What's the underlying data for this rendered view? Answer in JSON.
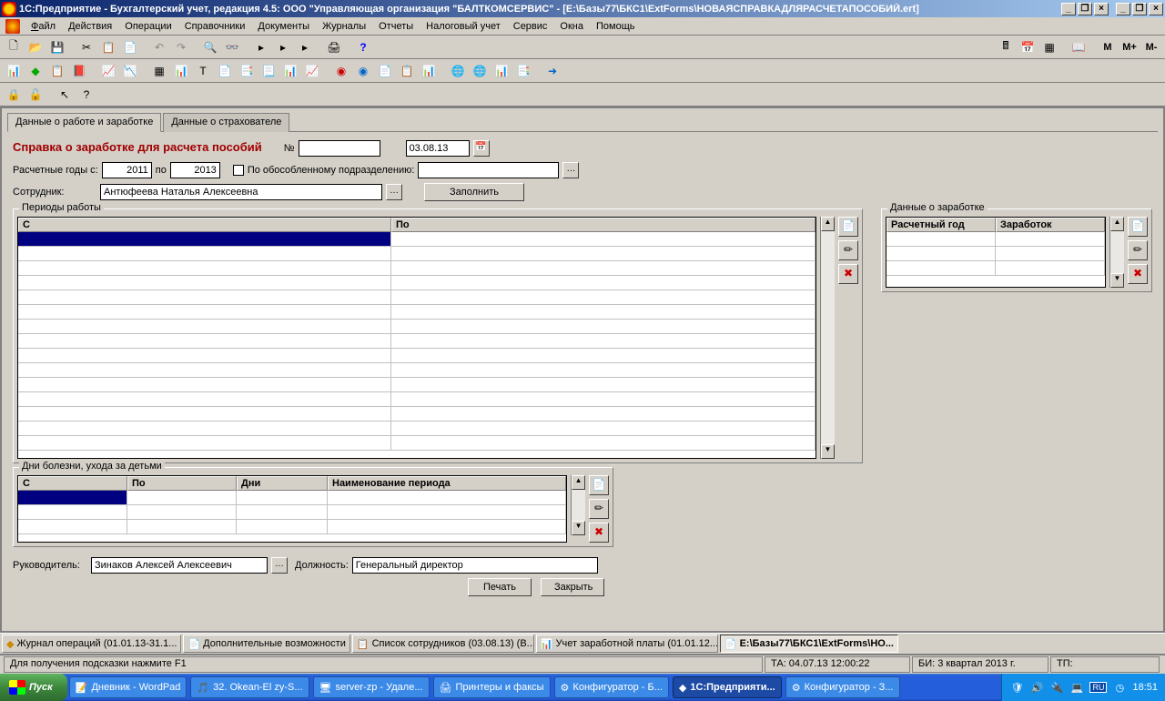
{
  "titlebar": {
    "text": "1С:Предприятие - Бухгалтерский учет, редакция 4.5: ООО \"Управляющая организация \"БАЛТКОМСЕРВИС\" - [E:\\Базы77\\БКС1\\ExtForms\\НОВАЯСПРАВКАДЛЯРАСЧЕТАПОСОБИЙ.ert]"
  },
  "menu": {
    "file": "Файл",
    "actions": "Действия",
    "operations": "Операции",
    "refs": "Справочники",
    "docs": "Документы",
    "journals": "Журналы",
    "reports": "Отчеты",
    "tax": "Налоговый учет",
    "service": "Сервис",
    "windows": "Окна",
    "help": "Помощь"
  },
  "tabs": {
    "t1": "Данные о работе и заработке",
    "t2": "Данные о страхователе"
  },
  "form": {
    "title": "Справка о заработке для расчета пособий",
    "num_label": "№",
    "num_value": "",
    "date_value": "03.08.13",
    "years_label": "Расчетные годы с:",
    "year_from": "2011",
    "year_to_label": "по",
    "year_to": "2013",
    "subdiv_chk_label": "По обособленному подразделению:",
    "subdiv_value": "",
    "emp_label": "Сотрудник:",
    "emp_value": "Антюфеева Наталья Алексеевна",
    "fill_btn": "Заполнить",
    "periods_legend": "Периоды работы",
    "col_from": "С",
    "col_to": "По",
    "earn_legend": "Данные о заработке",
    "col_year": "Расчетный год",
    "col_earn": "Заработок",
    "sick_legend": "Дни болезни, ухода за детьми",
    "col_days": "Дни",
    "col_name": "Наименование периода",
    "head_label": "Руководитель:",
    "head_value": "Зинаков Алексей Алексеевич",
    "pos_label": "Должность:",
    "pos_value": "Генеральный директор",
    "print_btn": "Печать",
    "close_btn": "Закрыть"
  },
  "docs": {
    "d1": "Журнал операций  (01.01.13-31.1...",
    "d2": "Дополнительные возможности",
    "d3": "Список сотрудников (03.08.13) (В...",
    "d4": "Учет заработной платы (01.01.12...",
    "d5": "E:\\Базы77\\БКС1\\ExtForms\\НО..."
  },
  "status": {
    "help": "Для получения подсказки нажмите F1",
    "ta": "ТА: 04.07.13  12:00:22",
    "bi": "БИ: 3 квартал 2013 г.",
    "tp": "ТП:"
  },
  "taskbar": {
    "start": "Пуск",
    "b1": "Дневник - WordPad",
    "b2": "32. Okean-El zy-S...",
    "b3": "server-zp  -  Удале...",
    "b4": "Принтеры и факсы",
    "b5": "Конфигуратор - Б...",
    "b6": "1С:Предприяти...",
    "b7": "Конфигуратор - З...",
    "ru": "RU",
    "time": "18:51"
  }
}
